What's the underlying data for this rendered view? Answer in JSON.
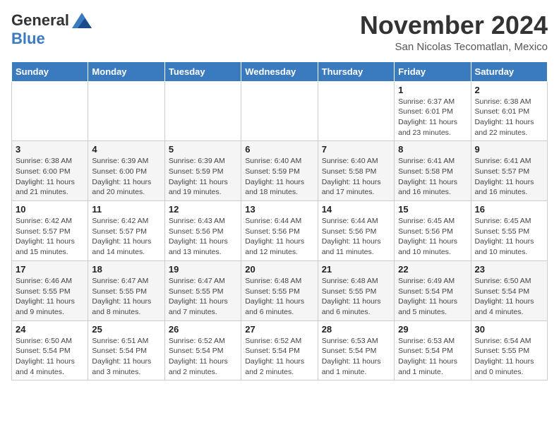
{
  "logo": {
    "general": "General",
    "blue": "Blue"
  },
  "header": {
    "month": "November 2024",
    "location": "San Nicolas Tecomatlan, Mexico"
  },
  "days_of_week": [
    "Sunday",
    "Monday",
    "Tuesday",
    "Wednesday",
    "Thursday",
    "Friday",
    "Saturday"
  ],
  "weeks": [
    [
      {
        "day": "",
        "info": ""
      },
      {
        "day": "",
        "info": ""
      },
      {
        "day": "",
        "info": ""
      },
      {
        "day": "",
        "info": ""
      },
      {
        "day": "",
        "info": ""
      },
      {
        "day": "1",
        "info": "Sunrise: 6:37 AM\nSunset: 6:01 PM\nDaylight: 11 hours and 23 minutes."
      },
      {
        "day": "2",
        "info": "Sunrise: 6:38 AM\nSunset: 6:01 PM\nDaylight: 11 hours and 22 minutes."
      }
    ],
    [
      {
        "day": "3",
        "info": "Sunrise: 6:38 AM\nSunset: 6:00 PM\nDaylight: 11 hours and 21 minutes."
      },
      {
        "day": "4",
        "info": "Sunrise: 6:39 AM\nSunset: 6:00 PM\nDaylight: 11 hours and 20 minutes."
      },
      {
        "day": "5",
        "info": "Sunrise: 6:39 AM\nSunset: 5:59 PM\nDaylight: 11 hours and 19 minutes."
      },
      {
        "day": "6",
        "info": "Sunrise: 6:40 AM\nSunset: 5:59 PM\nDaylight: 11 hours and 18 minutes."
      },
      {
        "day": "7",
        "info": "Sunrise: 6:40 AM\nSunset: 5:58 PM\nDaylight: 11 hours and 17 minutes."
      },
      {
        "day": "8",
        "info": "Sunrise: 6:41 AM\nSunset: 5:58 PM\nDaylight: 11 hours and 16 minutes."
      },
      {
        "day": "9",
        "info": "Sunrise: 6:41 AM\nSunset: 5:57 PM\nDaylight: 11 hours and 16 minutes."
      }
    ],
    [
      {
        "day": "10",
        "info": "Sunrise: 6:42 AM\nSunset: 5:57 PM\nDaylight: 11 hours and 15 minutes."
      },
      {
        "day": "11",
        "info": "Sunrise: 6:42 AM\nSunset: 5:57 PM\nDaylight: 11 hours and 14 minutes."
      },
      {
        "day": "12",
        "info": "Sunrise: 6:43 AM\nSunset: 5:56 PM\nDaylight: 11 hours and 13 minutes."
      },
      {
        "day": "13",
        "info": "Sunrise: 6:44 AM\nSunset: 5:56 PM\nDaylight: 11 hours and 12 minutes."
      },
      {
        "day": "14",
        "info": "Sunrise: 6:44 AM\nSunset: 5:56 PM\nDaylight: 11 hours and 11 minutes."
      },
      {
        "day": "15",
        "info": "Sunrise: 6:45 AM\nSunset: 5:56 PM\nDaylight: 11 hours and 10 minutes."
      },
      {
        "day": "16",
        "info": "Sunrise: 6:45 AM\nSunset: 5:55 PM\nDaylight: 11 hours and 10 minutes."
      }
    ],
    [
      {
        "day": "17",
        "info": "Sunrise: 6:46 AM\nSunset: 5:55 PM\nDaylight: 11 hours and 9 minutes."
      },
      {
        "day": "18",
        "info": "Sunrise: 6:47 AM\nSunset: 5:55 PM\nDaylight: 11 hours and 8 minutes."
      },
      {
        "day": "19",
        "info": "Sunrise: 6:47 AM\nSunset: 5:55 PM\nDaylight: 11 hours and 7 minutes."
      },
      {
        "day": "20",
        "info": "Sunrise: 6:48 AM\nSunset: 5:55 PM\nDaylight: 11 hours and 6 minutes."
      },
      {
        "day": "21",
        "info": "Sunrise: 6:48 AM\nSunset: 5:55 PM\nDaylight: 11 hours and 6 minutes."
      },
      {
        "day": "22",
        "info": "Sunrise: 6:49 AM\nSunset: 5:54 PM\nDaylight: 11 hours and 5 minutes."
      },
      {
        "day": "23",
        "info": "Sunrise: 6:50 AM\nSunset: 5:54 PM\nDaylight: 11 hours and 4 minutes."
      }
    ],
    [
      {
        "day": "24",
        "info": "Sunrise: 6:50 AM\nSunset: 5:54 PM\nDaylight: 11 hours and 4 minutes."
      },
      {
        "day": "25",
        "info": "Sunrise: 6:51 AM\nSunset: 5:54 PM\nDaylight: 11 hours and 3 minutes."
      },
      {
        "day": "26",
        "info": "Sunrise: 6:52 AM\nSunset: 5:54 PM\nDaylight: 11 hours and 2 minutes."
      },
      {
        "day": "27",
        "info": "Sunrise: 6:52 AM\nSunset: 5:54 PM\nDaylight: 11 hours and 2 minutes."
      },
      {
        "day": "28",
        "info": "Sunrise: 6:53 AM\nSunset: 5:54 PM\nDaylight: 11 hours and 1 minute."
      },
      {
        "day": "29",
        "info": "Sunrise: 6:53 AM\nSunset: 5:54 PM\nDaylight: 11 hours and 1 minute."
      },
      {
        "day": "30",
        "info": "Sunrise: 6:54 AM\nSunset: 5:55 PM\nDaylight: 11 hours and 0 minutes."
      }
    ]
  ]
}
